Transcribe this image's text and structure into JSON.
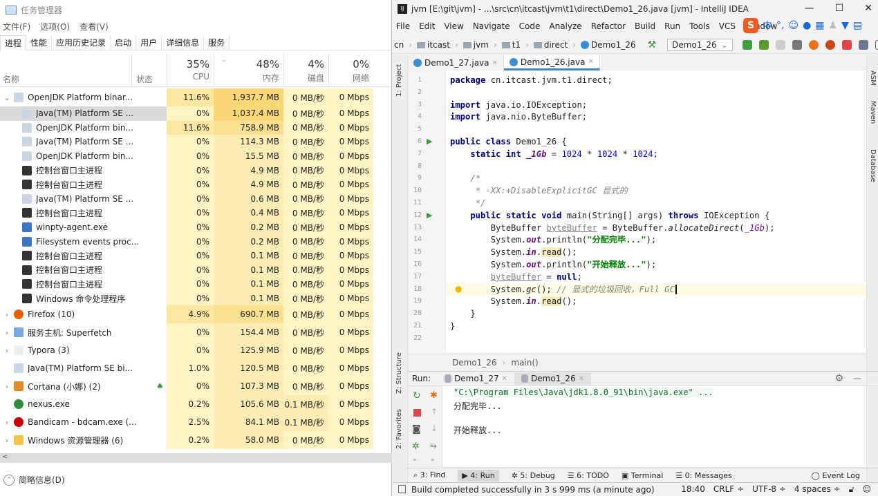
{
  "taskmgr": {
    "title": "任务管理器",
    "menu": [
      "文件(F)",
      "选项(O)",
      "查看(V)"
    ],
    "tabs": [
      "进程",
      "性能",
      "应用历史记录",
      "启动",
      "用户",
      "详细信息",
      "服务"
    ],
    "active_tab": 0,
    "columns": {
      "name": "名称",
      "status": "状态",
      "cpu_pct": "35%",
      "cpu": "CPU",
      "mem_pct": "48%",
      "mem": "内存",
      "disk_pct": "4%",
      "disk": "磁盘",
      "net_pct": "0%",
      "net": "网络"
    },
    "rows": [
      {
        "level": 0,
        "expand": "expanded",
        "icon": "java-icon",
        "name": "OpenJDK Platform binar...",
        "cpu": "11.6%",
        "mem": "1,937.7 MB",
        "disk": "0 MB/秒",
        "net": "0 Mbps"
      },
      {
        "level": 1,
        "icon": "java-icon",
        "name": "Java(TM) Platform SE ...",
        "cpu": "0%",
        "mem": "1,037.4 MB",
        "disk": "0 MB/秒",
        "net": "0 Mbps",
        "selected": true
      },
      {
        "level": 1,
        "icon": "java-icon",
        "name": "OpenJDK Platform bin...",
        "cpu": "11.6%",
        "mem": "758.9 MB",
        "disk": "0 MB/秒",
        "net": "0 Mbps"
      },
      {
        "level": 1,
        "icon": "java-icon",
        "name": "Java(TM) Platform SE ...",
        "cpu": "0%",
        "mem": "114.3 MB",
        "disk": "0 MB/秒",
        "net": "0 Mbps"
      },
      {
        "level": 1,
        "icon": "java-icon",
        "name": "OpenJDK Platform bin...",
        "cpu": "0%",
        "mem": "15.5 MB",
        "disk": "0 MB/秒",
        "net": "0 Mbps"
      },
      {
        "level": 1,
        "icon": "console-icon",
        "name": "控制台窗口主进程",
        "cpu": "0%",
        "mem": "4.9 MB",
        "disk": "0 MB/秒",
        "net": "0 Mbps"
      },
      {
        "level": 1,
        "icon": "console-icon",
        "name": "控制台窗口主进程",
        "cpu": "0%",
        "mem": "4.9 MB",
        "disk": "0 MB/秒",
        "net": "0 Mbps"
      },
      {
        "level": 1,
        "icon": "java-icon",
        "name": "Java(TM) Platform SE ...",
        "cpu": "0%",
        "mem": "0.6 MB",
        "disk": "0 MB/秒",
        "net": "0 Mbps"
      },
      {
        "level": 1,
        "icon": "console-icon",
        "name": "控制台窗口主进程",
        "cpu": "0%",
        "mem": "0.4 MB",
        "disk": "0 MB/秒",
        "net": "0 Mbps"
      },
      {
        "level": 1,
        "icon": "window-icon",
        "name": "winpty-agent.exe",
        "cpu": "0%",
        "mem": "0.2 MB",
        "disk": "0 MB/秒",
        "net": "0 Mbps"
      },
      {
        "level": 1,
        "icon": "window-icon",
        "name": "Filesystem events proc...",
        "cpu": "0%",
        "mem": "0.2 MB",
        "disk": "0 MB/秒",
        "net": "0 Mbps"
      },
      {
        "level": 1,
        "icon": "console-icon",
        "name": "控制台窗口主进程",
        "cpu": "0%",
        "mem": "0.1 MB",
        "disk": "0 MB/秒",
        "net": "0 Mbps"
      },
      {
        "level": 1,
        "icon": "console-icon",
        "name": "控制台窗口主进程",
        "cpu": "0%",
        "mem": "0.1 MB",
        "disk": "0 MB/秒",
        "net": "0 Mbps"
      },
      {
        "level": 1,
        "icon": "console-icon",
        "name": "控制台窗口主进程",
        "cpu": "0%",
        "mem": "0.1 MB",
        "disk": "0 MB/秒",
        "net": "0 Mbps"
      },
      {
        "level": 1,
        "icon": "console-icon",
        "name": "Windows 命令处理程序",
        "cpu": "0%",
        "mem": "0.1 MB",
        "disk": "0 MB/秒",
        "net": "0 Mbps"
      },
      {
        "level": 0,
        "expand": "collapsed",
        "icon": "firefox-icon",
        "name": "Firefox (10)",
        "cpu": "4.9%",
        "mem": "690.7 MB",
        "disk": "0 MB/秒",
        "net": "0 Mbps"
      },
      {
        "level": 0,
        "expand": "collapsed",
        "icon": "gear-icon",
        "name": "服务主机: Superfetch",
        "cpu": "0%",
        "mem": "154.4 MB",
        "disk": "0 MB/秒",
        "net": "0 Mbps"
      },
      {
        "level": 0,
        "expand": "collapsed",
        "icon": "typora-icon",
        "name": "Typora (3)",
        "cpu": "0%",
        "mem": "125.9 MB",
        "disk": "0 MB/秒",
        "net": "0 Mbps"
      },
      {
        "level": 0,
        "expand": "none",
        "icon": "java-icon",
        "name": "Java(TM) Platform SE bi...",
        "cpu": "1.0%",
        "mem": "120.5 MB",
        "disk": "0 MB/秒",
        "net": "0 Mbps"
      },
      {
        "level": 0,
        "expand": "collapsed",
        "icon": "cortana-icon",
        "name": "Cortana (小娜) (2)",
        "status_icon": "leaf-icon",
        "cpu": "0%",
        "mem": "107.3 MB",
        "disk": "0 MB/秒",
        "net": "0 Mbps"
      },
      {
        "level": 0,
        "expand": "none",
        "icon": "nexus-icon",
        "name": "nexus.exe",
        "cpu": "0.2%",
        "mem": "105.6 MB",
        "disk": "0.1 MB/秒",
        "net": "0 Mbps"
      },
      {
        "level": 0,
        "expand": "collapsed",
        "icon": "bandicam-icon",
        "name": "Bandicam - bdcam.exe (...",
        "cpu": "2.5%",
        "mem": "84.1 MB",
        "disk": "0.1 MB/秒",
        "net": "0 Mbps"
      },
      {
        "level": 0,
        "expand": "collapsed",
        "icon": "folder-icon",
        "name": "Windows 资源管理器 (6)",
        "cpu": "0.2%",
        "mem": "58.0 MB",
        "disk": "0 MB/秒",
        "net": "0 Mbps"
      }
    ],
    "footer": "简略信息(D)"
  },
  "ide": {
    "title": "jvm [E:\\git\\jvm] - ...\\src\\cn\\itcast\\jvm\\t1\\direct\\Demo1_26.java [jvm] - IntelliJ IDEA",
    "menu": [
      "File",
      "Edit",
      "View",
      "Navigate",
      "Code",
      "Analyze",
      "Refactor",
      "Build",
      "Run",
      "Tools",
      "VCS",
      "Window"
    ],
    "ime": [
      "S",
      "中",
      "°,",
      "☺",
      "🎤",
      "⌨"
    ],
    "breadcrumb": [
      "cn",
      "itcast",
      "jvm",
      "t1",
      "direct",
      "Demo1_26"
    ],
    "run_config": "Demo1_26",
    "tabs": [
      {
        "label": "Demo1_27.java",
        "active": false
      },
      {
        "label": "Demo1_26.java",
        "active": true
      }
    ],
    "left_strip": [
      "1: Project",
      "Z: Structure",
      "2: Favorites"
    ],
    "right_strip": [
      "ASM",
      "Maven",
      "Database"
    ],
    "code": [
      [
        [
          "package ",
          "kw"
        ],
        [
          "cn.itcast.jvm.t1.direct;",
          ""
        ]
      ],
      [],
      [
        [
          "import ",
          "kw"
        ],
        [
          "java.io.IOException;",
          ""
        ]
      ],
      [
        [
          "import ",
          "kw"
        ],
        [
          "java.nio.ByteBuffer;",
          ""
        ]
      ],
      [],
      [
        [
          "public class ",
          "kw"
        ],
        [
          "Demo1_26 {",
          ""
        ]
      ],
      [
        [
          "    static int ",
          "kw"
        ],
        [
          "_1Gb",
          "fld"
        ],
        [
          " = ",
          ""
        ],
        [
          "1024",
          "num"
        ],
        [
          " * ",
          ""
        ],
        [
          "1024",
          "num"
        ],
        [
          " * ",
          ""
        ],
        [
          "1024",
          "num"
        ],
        [
          ";",
          ""
        ]
      ],
      [],
      [
        [
          "    /*",
          "cm"
        ]
      ],
      [
        [
          "     * -XX:+DisableExplicitGC 显式的",
          "cm"
        ]
      ],
      [
        [
          "     */",
          "cm"
        ]
      ],
      [
        [
          "    public static void ",
          "kw"
        ],
        [
          "main(String[] args) ",
          ""
        ],
        [
          "throws ",
          "kw"
        ],
        [
          "IOException {",
          ""
        ]
      ],
      [
        [
          "        ByteBuffer ",
          ""
        ],
        [
          "byteBuffer",
          "unused"
        ],
        [
          " = ByteBuffer.",
          ""
        ],
        [
          "allocateDirect",
          "st"
        ],
        [
          "(",
          ""
        ],
        [
          "_1Gb",
          "iv"
        ],
        [
          ");",
          ""
        ]
      ],
      [
        [
          "        System.",
          ""
        ],
        [
          "out",
          "fld"
        ],
        [
          ".println(",
          ""
        ],
        [
          "\"分配完毕...\"",
          "str"
        ],
        [
          ");",
          ""
        ]
      ],
      [
        [
          "        System.",
          ""
        ],
        [
          "in",
          "fld"
        ],
        [
          ".",
          ""
        ],
        [
          "read",
          "rd"
        ],
        [
          "();",
          ""
        ]
      ],
      [
        [
          "        System.",
          ""
        ],
        [
          "out",
          "fld"
        ],
        [
          ".println(",
          ""
        ],
        [
          "\"开始释放...\"",
          "str"
        ],
        [
          ");",
          ""
        ]
      ],
      [
        [
          "        ",
          ""
        ],
        [
          "byteBuffer",
          "unused"
        ],
        [
          " = ",
          ""
        ],
        [
          "null",
          "kw"
        ],
        [
          ";",
          ""
        ]
      ],
      [
        [
          "        System.",
          ""
        ],
        [
          "gc",
          "st"
        ],
        [
          "(); ",
          ""
        ],
        [
          "// 显式的垃圾回收，Full GC",
          "cm"
        ]
      ],
      [
        [
          "        System.",
          ""
        ],
        [
          "in",
          "fld"
        ],
        [
          ".",
          ""
        ],
        [
          "read",
          "rd"
        ],
        [
          "();",
          ""
        ]
      ],
      [
        [
          "    }",
          ""
        ]
      ],
      [
        [
          "}",
          ""
        ]
      ],
      []
    ],
    "run_lines": [
      12,
      6
    ],
    "current_line": 18,
    "code_breadcrumb": [
      "Demo1_26",
      "main()"
    ],
    "run": {
      "label": "Run:",
      "tabs": [
        "Demo1_27",
        "Demo1_26"
      ],
      "active_tab": 1,
      "output": [
        "\"C:\\Program Files\\Java\\jdk1.8.0_91\\bin\\java.exe\" ...",
        "分配完毕...",
        "",
        "开始释放..."
      ]
    },
    "bottom_tabs": [
      "3: Find",
      "4: Run",
      "5: Debug",
      "6: TODO",
      "Terminal",
      "0: Messages",
      "Event Log"
    ],
    "active_bottom_tab": 1,
    "status": {
      "message": "Build completed successfully in 3 s 999 ms (a minute ago)",
      "position": "18:40",
      "line_sep": "CRLF ÷",
      "encoding": "UTF-8 ÷",
      "indent": "4 spaces ÷"
    }
  }
}
